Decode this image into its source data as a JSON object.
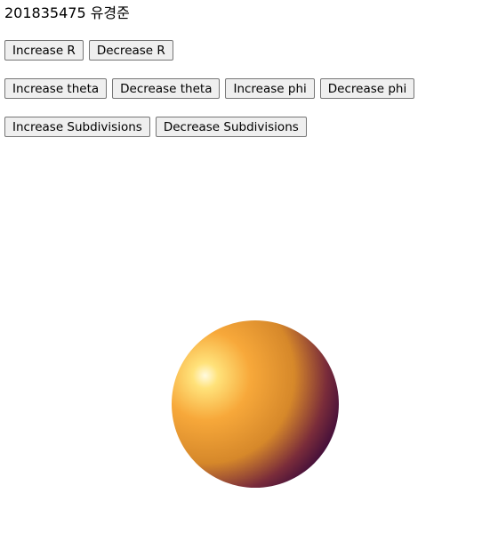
{
  "header": {
    "title": "201835475 유경준"
  },
  "controls": {
    "radius": {
      "increase_label": "Increase R",
      "decrease_label": "Decrease R"
    },
    "angles": {
      "increase_theta_label": "Increase theta",
      "decrease_theta_label": "Decrease theta",
      "increase_phi_label": "Increase phi",
      "decrease_phi_label": "Decrease phi"
    },
    "subdivisions": {
      "increase_label": "Increase Subdivisions",
      "decrease_label": "Decrease Subdivisions"
    }
  },
  "scene": {
    "object": "sphere",
    "colors": {
      "highlight": "#fffbe0",
      "base": "#f7a83a",
      "mid": "#d6882a",
      "shadow": "#7a2c3a",
      "dark": "#3a0a3a"
    }
  }
}
